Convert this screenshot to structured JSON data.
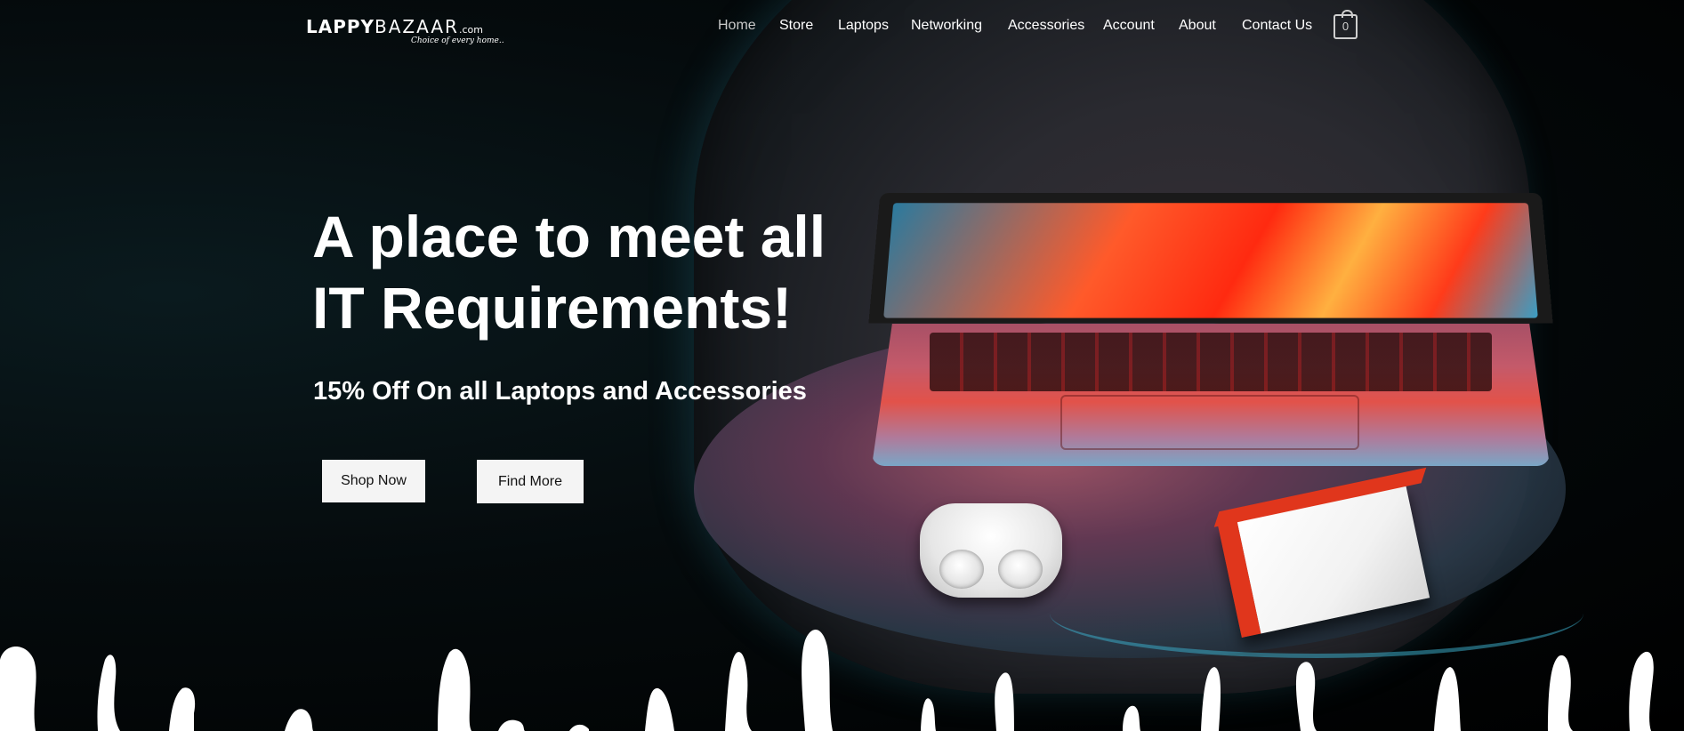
{
  "brand": {
    "name_bold": "LAPPY",
    "name_thin": "BAZAAR",
    "name_suffix": ".com",
    "tagline": "Choice of every home.."
  },
  "nav": {
    "items": [
      "Home",
      "Store",
      "Laptops",
      "Networking",
      "Accessories",
      "Account",
      "About",
      "Contact Us"
    ],
    "active": "Home",
    "cart_count": "0"
  },
  "hero": {
    "headline_line1": "A place to meet all",
    "headline_line2": "IT Requirements!",
    "subheadline": "15% Off On all Laptops and Accessories",
    "shop_button": "Shop Now",
    "find_button": "Find More"
  },
  "colors": {
    "background": "#000000",
    "text": "#ffffff",
    "button_bg": "#f4f4f4",
    "accent_red": "#e0361c"
  },
  "icons": [
    "shopping-bag-icon"
  ]
}
